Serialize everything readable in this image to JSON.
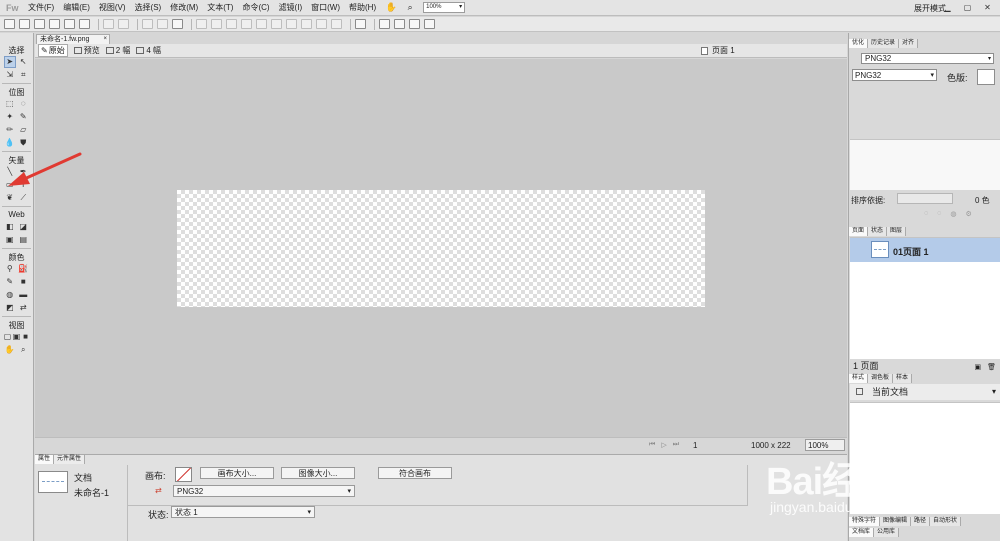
{
  "app": {
    "logo": "Fw",
    "workspace": "展开模式"
  },
  "menu": [
    "文件(F)",
    "编辑(E)",
    "视图(V)",
    "选择(S)",
    "修改(M)",
    "文本(T)",
    "命令(C)",
    "滤镜(I)",
    "窗口(W)",
    "帮助(H)"
  ],
  "menubar_tools": {
    "zoom": "100%"
  },
  "document": {
    "tab": "未命名-1.fw.png"
  },
  "view_tabs": [
    "原始",
    "预览",
    "2 幅",
    "4 幅"
  ],
  "page_select": "页面 1",
  "tools": {
    "sections": [
      "选择",
      "位图",
      "矢量",
      "Web",
      "颜色",
      "视图"
    ]
  },
  "status": {
    "frame": "1",
    "canvas_size": "1000 x 222",
    "zoom": "100%"
  },
  "properties": {
    "tabs": [
      "属性",
      "元件属性"
    ],
    "doc_type": "文档",
    "doc_name": "未命名-1",
    "canvas_label": "画布:",
    "canvas_size_button": "画布大小...",
    "image_size_button": "图像大小...",
    "fit_canvas_button": "符合画布",
    "export_format": "PNG32",
    "state_label": "状态:",
    "state_value": "状态 1"
  },
  "optimize": {
    "tabs": [
      "优化",
      "历史记录",
      "对齐"
    ],
    "preset": "PNG32",
    "format": "PNG32",
    "matte_label": "色版:",
    "sort_label": "排序依据:",
    "color_count": "0 色"
  },
  "pages": {
    "tabs": [
      "页面",
      "状态",
      "图层"
    ],
    "row_label": "01页面 1",
    "footer": "1 页面"
  },
  "styles": {
    "tabs": [
      "样式",
      "调色板",
      "样本"
    ],
    "select": "当前文档"
  },
  "bottom_tabs_1": [
    "特殊字符",
    "图像编辑",
    "路径",
    "自动形状"
  ],
  "bottom_tabs_2": [
    "文档库",
    "公用库"
  ],
  "watermark": {
    "logo": "Bai经验",
    "url": "jingyan.baidu.com"
  }
}
